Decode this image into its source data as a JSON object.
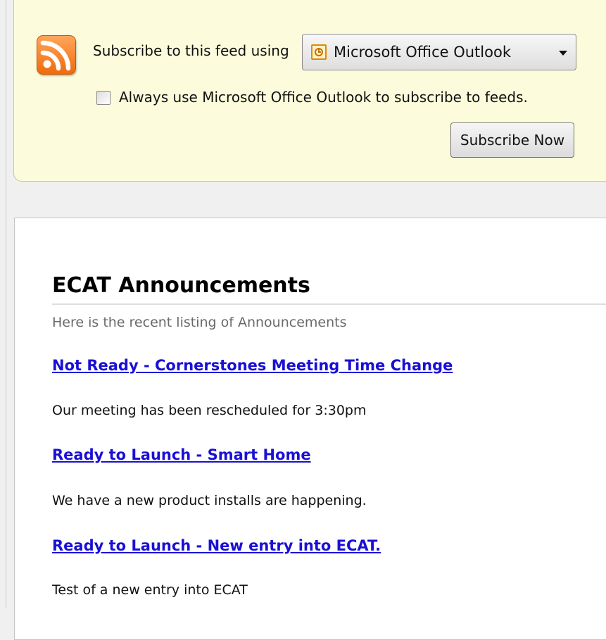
{
  "subscribe_bar": {
    "label": "Subscribe to this feed using",
    "reader_options_selected": "Microsoft Office Outlook",
    "always_use_label": "Always use Microsoft Office Outlook to subscribe to feeds.",
    "always_use_checked": false,
    "subscribe_button": "Subscribe Now",
    "icons": {
      "feed": "rss-feed-icon",
      "reader": "outlook-clock-icon",
      "dropdown": "chevron-down-icon"
    }
  },
  "feed": {
    "title": "ECAT Announcements",
    "subtitle": "Here is the recent listing of Announcements",
    "entries": [
      {
        "title": "Not Ready - Cornerstones Meeting Time Change",
        "description": "Our meeting has been rescheduled for 3:30pm"
      },
      {
        "title": "Ready to Launch - Smart Home",
        "description": "We have a new product installs are happening."
      },
      {
        "title": "Ready to Launch - New entry into ECAT.",
        "description": "Test of a new entry into ECAT"
      }
    ]
  },
  "colors": {
    "banner_bg": "#fcfcdc",
    "link": "#1a0fd6",
    "rss_orange": "#f06b0b"
  }
}
